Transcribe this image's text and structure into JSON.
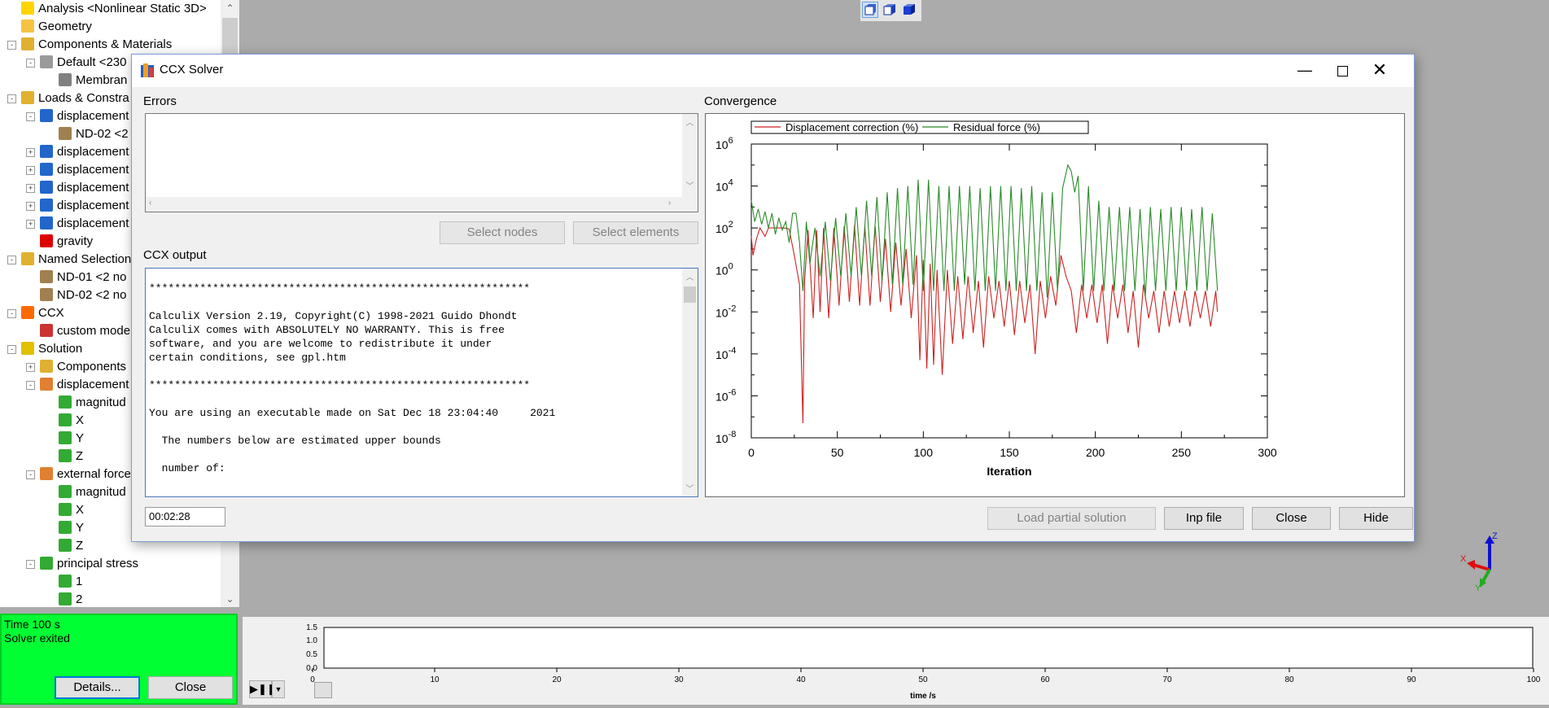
{
  "tree": {
    "items": [
      {
        "label": "Analysis <Nonlinear Static 3D>",
        "level": 0,
        "expander": "",
        "icon": "analysis-icon",
        "color": "#ffd400"
      },
      {
        "label": "Geometry",
        "level": 0,
        "expander": "",
        "icon": "folder-icon",
        "color": "#f6c342"
      },
      {
        "label": "Components & Materials",
        "level": 0,
        "expander": "-",
        "icon": "components-icon",
        "color": "#e0b030"
      },
      {
        "label": "Default <230",
        "level": 1,
        "expander": "-",
        "icon": "component-icon",
        "color": "#9a9a9a"
      },
      {
        "label": "Membran",
        "level": 2,
        "expander": "",
        "icon": "membrane-icon",
        "color": "#808080"
      },
      {
        "label": "Loads & Constra",
        "level": 0,
        "expander": "-",
        "icon": "loads-icon",
        "color": "#e0b030"
      },
      {
        "label": "displacement",
        "level": 1,
        "expander": "-",
        "icon": "displacement-icon",
        "color": "#2266cc"
      },
      {
        "label": "ND-02 <2",
        "level": 2,
        "expander": "",
        "icon": "node-set-icon",
        "color": "#a08050"
      },
      {
        "label": "displacement",
        "level": 1,
        "expander": "+",
        "icon": "displacement-icon",
        "color": "#2266cc"
      },
      {
        "label": "displacement",
        "level": 1,
        "expander": "+",
        "icon": "displacement-icon",
        "color": "#2266cc"
      },
      {
        "label": "displacement",
        "level": 1,
        "expander": "+",
        "icon": "displacement-icon",
        "color": "#2266cc"
      },
      {
        "label": "displacement",
        "level": 1,
        "expander": "+",
        "icon": "displacement-icon",
        "color": "#2266cc"
      },
      {
        "label": "displacement",
        "level": 1,
        "expander": "+",
        "icon": "displacement-icon",
        "color": "#2266cc"
      },
      {
        "label": "gravity",
        "level": 1,
        "expander": "",
        "icon": "gravity-icon",
        "color": "#dd0000"
      },
      {
        "label": "Named Selection",
        "level": 0,
        "expander": "-",
        "icon": "named-selection-icon",
        "color": "#e0b030"
      },
      {
        "label": "ND-01 <2 no",
        "level": 1,
        "expander": "",
        "icon": "node-set-icon",
        "color": "#a08050"
      },
      {
        "label": "ND-02 <2 no",
        "level": 1,
        "expander": "",
        "icon": "node-set-icon",
        "color": "#a08050"
      },
      {
        "label": "CCX",
        "level": 0,
        "expander": "-",
        "icon": "ccx-icon",
        "color": "#ff6a00"
      },
      {
        "label": "custom mode",
        "level": 1,
        "expander": "",
        "icon": "custom-model-icon",
        "color": "#cc3333"
      },
      {
        "label": "Solution",
        "level": 0,
        "expander": "-",
        "icon": "solution-icon",
        "color": "#e0c000"
      },
      {
        "label": "Components",
        "level": 1,
        "expander": "+",
        "icon": "components-icon",
        "color": "#e0b030"
      },
      {
        "label": "displacement",
        "level": 1,
        "expander": "-",
        "icon": "result-vector-icon",
        "color": "#e08030"
      },
      {
        "label": "magnitud",
        "level": 2,
        "expander": "",
        "icon": "result-icon",
        "color": "#33aa33"
      },
      {
        "label": "X",
        "level": 2,
        "expander": "",
        "icon": "result-icon",
        "color": "#33aa33"
      },
      {
        "label": "Y",
        "level": 2,
        "expander": "",
        "icon": "result-icon",
        "color": "#33aa33"
      },
      {
        "label": "Z",
        "level": 2,
        "expander": "",
        "icon": "result-icon",
        "color": "#33aa33"
      },
      {
        "label": "external force",
        "level": 1,
        "expander": "-",
        "icon": "result-vector-icon",
        "color": "#e08030"
      },
      {
        "label": "magnitud",
        "level": 2,
        "expander": "",
        "icon": "result-icon",
        "color": "#33aa33"
      },
      {
        "label": "X",
        "level": 2,
        "expander": "",
        "icon": "result-icon",
        "color": "#33aa33"
      },
      {
        "label": "Y",
        "level": 2,
        "expander": "",
        "icon": "result-icon",
        "color": "#33aa33"
      },
      {
        "label": "Z",
        "level": 2,
        "expander": "",
        "icon": "result-icon",
        "color": "#33aa33"
      },
      {
        "label": "principal stress",
        "level": 1,
        "expander": "-",
        "icon": "result-icon",
        "color": "#33aa33"
      },
      {
        "label": "1",
        "level": 2,
        "expander": "",
        "icon": "result-icon",
        "color": "#33aa33"
      },
      {
        "label": "2",
        "level": 2,
        "expander": "",
        "icon": "result-icon",
        "color": "#33aa33"
      }
    ]
  },
  "status_panel": {
    "line1": "Time 100 s",
    "line2": "Solver exited",
    "details_label": "Details...",
    "close_label": "Close",
    "bg_color": "#00ff33"
  },
  "dialog": {
    "title": "CCX Solver",
    "errors_label": "Errors",
    "errors_text": "",
    "select_nodes_label": "Select nodes",
    "select_elements_label": "Select elements",
    "ccx_output_label": "CCX output",
    "ccx_output_lines": [
      "************************************************************",
      "",
      "CalculiX Version 2.19, Copyright(C) 1998-2021 Guido Dhondt",
      "CalculiX comes with ABSOLUTELY NO WARRANTY. This is free",
      "software, and you are welcome to redistribute it under",
      "certain conditions, see gpl.htm",
      "",
      "************************************************************",
      "",
      "You are using an executable made on Sat Dec 18 23:04:40     2021",
      "",
      "  The numbers below are estimated upper bounds",
      "",
      "  number of:",
      ""
    ],
    "elapsed": "00:02:28",
    "convergence_label": "Convergence",
    "load_partial_label": "Load partial solution",
    "inp_file_label": "Inp file",
    "close_label": "Close",
    "hide_label": "Hide"
  },
  "toolbar": {
    "icons": [
      "view-front-icon",
      "view-iso-icon",
      "view-solid-icon"
    ]
  },
  "triad": {
    "x": "X",
    "y": "Y",
    "z": "Z"
  },
  "time_plot": {
    "xlabel": "time /s",
    "yticks": [
      "1.5",
      "1.0",
      "0.5",
      "0.0"
    ],
    "xticks": [
      "0",
      "10",
      "20",
      "30",
      "40",
      "50",
      "60",
      "70",
      "80",
      "90",
      "100"
    ]
  },
  "chart_data": {
    "type": "line",
    "title": "",
    "xlabel": "Iteration",
    "ylabel": "",
    "yscale": "log",
    "xlim": [
      0,
      300
    ],
    "ylim": [
      1e-08,
      1000000.0
    ],
    "xticks": [
      "0",
      "50",
      "100",
      "150",
      "200",
      "250",
      "300"
    ],
    "legend_position": "top",
    "series": [
      {
        "name": "Displacement correction (%)",
        "color": "#cc2222",
        "x": [
          0,
          1,
          3,
          5,
          8,
          10,
          13,
          16,
          19,
          22,
          25,
          28,
          30,
          31,
          33,
          36,
          38,
          40,
          42,
          45,
          48,
          51,
          54,
          57,
          60,
          63,
          66,
          69,
          72,
          75,
          78,
          81,
          84,
          87,
          90,
          93,
          96,
          98,
          100,
          102,
          104,
          106,
          108,
          111,
          114,
          117,
          120,
          123,
          126,
          129,
          132,
          135,
          138,
          141,
          144,
          147,
          150,
          153,
          156,
          159,
          162,
          165,
          168,
          171,
          174,
          177,
          180,
          183,
          186,
          189,
          192,
          195,
          198,
          201,
          204,
          207,
          210,
          213,
          216,
          219,
          222,
          225,
          228,
          231,
          234,
          237,
          240,
          243,
          246,
          249,
          252,
          255,
          258,
          261,
          264,
          267,
          270,
          271
        ],
        "y": [
          40,
          5,
          30,
          100,
          40,
          100,
          100,
          100,
          100,
          90,
          5,
          0.2,
          5e-08,
          0.3,
          80,
          0.005,
          80,
          0.01,
          100,
          0.005,
          100,
          0.02,
          120,
          0.03,
          140,
          0.02,
          120,
          0.02,
          120,
          0.03,
          30,
          0.01,
          20,
          0.02,
          10,
          0.005,
          5,
          5e-05,
          3,
          2e-05,
          2,
          3e-05,
          1,
          1e-05,
          1,
          0.0003,
          0.5,
          0.0005,
          0.5,
          0.001,
          0.3,
          0.0002,
          0.5,
          0.005,
          0.3,
          0.002,
          0.3,
          0.0008,
          0.3,
          0.003,
          0.2,
          0.0001,
          0.3,
          0.005,
          0.5,
          0.02,
          5,
          0.5,
          0.1,
          0.001,
          0.2,
          0.005,
          0.2,
          0.003,
          0.2,
          0.0003,
          0.2,
          0.005,
          0.2,
          0.001,
          0.1,
          0.0002,
          0.2,
          0.005,
          0.1,
          0.001,
          0.1,
          0.002,
          0.1,
          0.003,
          0.1,
          0.002,
          0.1,
          0.005,
          0.1,
          0.002,
          0.1,
          0.01
        ]
      },
      {
        "name": "Residual force (%)",
        "color": "#2a8a2a",
        "x": [
          0,
          2,
          4,
          6,
          8,
          10,
          12,
          14,
          16,
          18,
          20,
          22,
          24,
          26,
          28,
          30,
          32,
          34,
          37,
          40,
          43,
          46,
          49,
          52,
          55,
          58,
          61,
          64,
          67,
          70,
          73,
          76,
          79,
          82,
          85,
          88,
          91,
          94,
          97,
          100,
          103,
          106,
          109,
          112,
          115,
          118,
          121,
          124,
          127,
          130,
          133,
          136,
          139,
          142,
          145,
          148,
          151,
          154,
          157,
          160,
          163,
          166,
          169,
          172,
          175,
          178,
          181,
          184,
          186,
          188,
          190,
          193,
          196,
          199,
          202,
          205,
          208,
          211,
          214,
          217,
          220,
          223,
          226,
          229,
          232,
          235,
          238,
          241,
          244,
          247,
          250,
          253,
          256,
          259,
          262,
          265,
          268,
          271
        ],
        "y": [
          2000,
          200,
          800,
          150,
          600,
          100,
          500,
          50,
          300,
          80,
          200,
          20,
          500,
          500,
          20,
          0.1,
          200,
          2,
          100,
          0.5,
          200,
          0.3,
          300,
          0.5,
          500,
          0.5,
          1000,
          0.5,
          2000,
          0.5,
          3000,
          0.3,
          5000,
          0.2,
          8000,
          0.2,
          10000,
          0.2,
          20000,
          0.1,
          20000,
          0.1,
          10000,
          0.1,
          10000,
          0.1,
          10000,
          0.2,
          10000,
          0.1,
          8000,
          0.1,
          10000,
          0.1,
          10000,
          0.1,
          10000,
          0.1,
          8000,
          0.1,
          10000,
          0.1,
          5000,
          0.05,
          5000,
          0.1,
          8000,
          100000,
          50000,
          5000,
          30000,
          0.1,
          10000,
          0.1,
          2000,
          0.1,
          1000,
          0.1,
          1000,
          0.1,
          1000,
          0.1,
          800,
          0.05,
          1000,
          0.1,
          800,
          0.1,
          1000,
          0.1,
          1000,
          0.1,
          800,
          0.1,
          1000,
          0.1,
          500,
          0.1
        ]
      }
    ]
  }
}
